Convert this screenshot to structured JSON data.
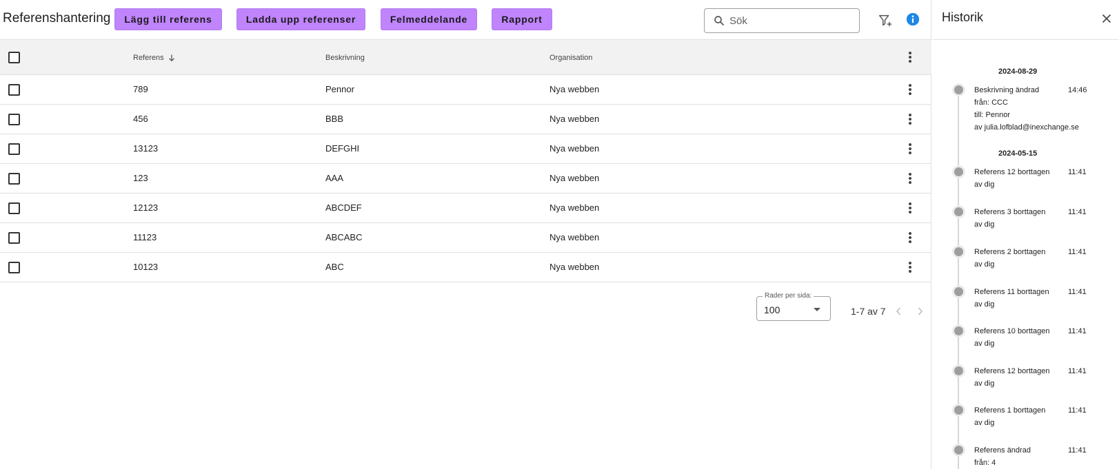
{
  "toolbar": {
    "title": "Referenshantering",
    "buttons": {
      "add": "Lägg till referens",
      "upload": "Ladda upp referenser",
      "error": "Felmeddelande",
      "report": "Rapport"
    },
    "search_placeholder": "Sök"
  },
  "table": {
    "columns": {
      "reference": "Referens",
      "description": "Beskrivning",
      "organisation": "Organisation"
    },
    "rows": [
      {
        "reference": "789",
        "description": "Pennor",
        "organisation": "Nya webben"
      },
      {
        "reference": "456",
        "description": "BBB",
        "organisation": "Nya webben"
      },
      {
        "reference": "13123",
        "description": "DEFGHI",
        "organisation": "Nya webben"
      },
      {
        "reference": "123",
        "description": "AAA",
        "organisation": "Nya webben"
      },
      {
        "reference": "12123",
        "description": "ABCDEF",
        "organisation": "Nya webben"
      },
      {
        "reference": "11123",
        "description": "ABCABC",
        "organisation": "Nya webben"
      },
      {
        "reference": "10123",
        "description": "ABC",
        "organisation": "Nya webben"
      }
    ]
  },
  "pagination": {
    "rows_per_page_label": "Rader per sida:",
    "rows_per_page": "100",
    "range": "1-7 av 7"
  },
  "history": {
    "title": "Historik",
    "groups": [
      {
        "date": "2024-08-29",
        "entries": [
          {
            "lines": [
              "Beskrivning ändrad",
              "från: CCC",
              "till: Pennor",
              "av julia.lofblad@inexchange.se"
            ],
            "time": "14:46"
          }
        ]
      },
      {
        "date": "2024-05-15",
        "entries": [
          {
            "lines": [
              "Referens 12 borttagen",
              "av dig"
            ],
            "time": "11:41"
          },
          {
            "lines": [
              "Referens 3 borttagen",
              "av dig"
            ],
            "time": "11:41"
          },
          {
            "lines": [
              "Referens 2 borttagen",
              "av dig"
            ],
            "time": "11:41"
          },
          {
            "lines": [
              "Referens 11 borttagen",
              "av dig"
            ],
            "time": "11:41"
          },
          {
            "lines": [
              "Referens 10 borttagen",
              "av dig"
            ],
            "time": "11:41"
          },
          {
            "lines": [
              "Referens 12 borttagen",
              "av dig"
            ],
            "time": "11:41"
          },
          {
            "lines": [
              "Referens 1 borttagen",
              "av dig"
            ],
            "time": "11:41"
          },
          {
            "lines": [
              "Referens ändrad",
              "från: 4"
            ],
            "time": "11:41"
          }
        ]
      }
    ]
  },
  "colors": {
    "button_purple": "#c084fc",
    "info_blue": "#1e88e5",
    "dot_grey": "#9e9e9e"
  },
  "icons": [
    "search-icon",
    "filter-add-icon",
    "info-icon",
    "kebab-menu-icon",
    "sort-arrow-down-icon",
    "chevron-left-icon",
    "chevron-right-icon",
    "close-icon",
    "caret-down-icon"
  ]
}
